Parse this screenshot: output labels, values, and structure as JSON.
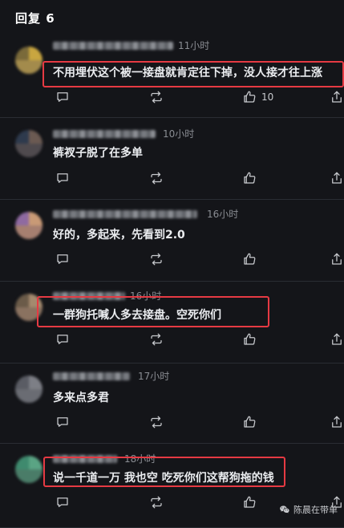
{
  "header": {
    "title": "回复 6"
  },
  "colors": {
    "highlight": "#e63a43",
    "background": "#141519",
    "divider": "#2a2d33"
  },
  "comments": [
    {
      "time": "11小时",
      "text": "不用埋伏这个被一接盘就肯定往下掉，没人接才往上涨",
      "like_count": "10",
      "highlighted": true,
      "avatar_colors": [
        "#7a6a3a",
        "#c9a640",
        "#a38b4c"
      ]
    },
    {
      "time": "10小时",
      "text": "裤衩子脱了在多单",
      "like_count": "",
      "highlighted": false,
      "avatar_colors": [
        "#2e3a4d",
        "#6b5a52",
        "#4f4a4e"
      ]
    },
    {
      "time": "16小时",
      "text": "好的，多起来，先看到2.0",
      "like_count": "",
      "highlighted": false,
      "avatar_colors": [
        "#8f6aa1",
        "#c99a76",
        "#a67f70"
      ]
    },
    {
      "time": "16小时",
      "text": "一群狗托喊人多去接盘。空死你们",
      "like_count": "",
      "highlighted": true,
      "avatar_colors": [
        "#6b5b49",
        "#a48a6e",
        "#8a7260"
      ]
    },
    {
      "time": "17小时",
      "text": "多来点多君",
      "like_count": "",
      "highlighted": false,
      "avatar_colors": [
        "#5a5c64",
        "#7d7f86",
        "#6a6c73"
      ]
    },
    {
      "time": "18小时",
      "text": "说一千道一万 我也空 吃死你们这帮狗拖的钱",
      "like_count": "",
      "highlighted": true,
      "avatar_colors": [
        "#3f8a6e",
        "#5aa484",
        "#4a7c68"
      ]
    }
  ],
  "icons": {
    "reply": "comment-icon",
    "repost": "repost-icon",
    "like": "thumbs-up-icon",
    "share": "share-icon"
  },
  "watermark": {
    "text": "陈晨在带单"
  }
}
